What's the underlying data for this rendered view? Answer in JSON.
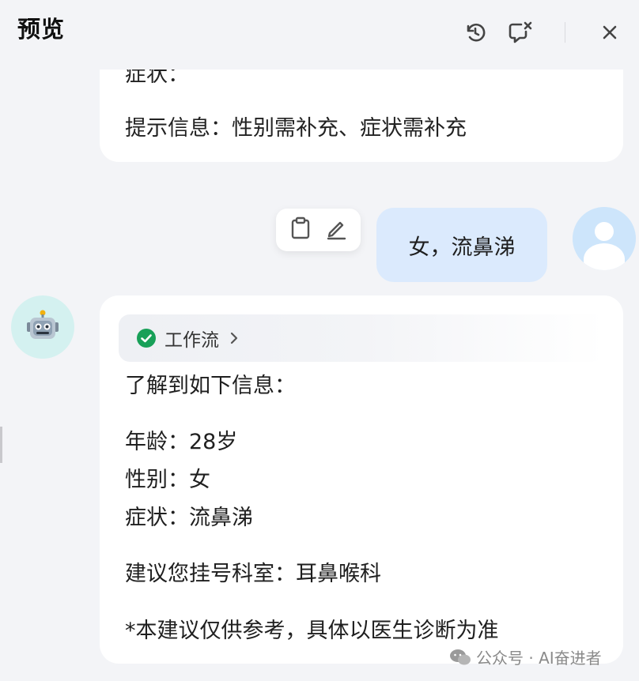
{
  "header": {
    "title": "预览",
    "icons": [
      "refresh-icon",
      "clear-chat-icon",
      "close-icon"
    ]
  },
  "messages": {
    "bot_prev": {
      "cut_line": "症状：",
      "hint_line": "提示信息：性别需补充、症状需补充"
    },
    "user": {
      "text": "女，流鼻涕",
      "actions": [
        "copy-icon",
        "edit-icon"
      ]
    },
    "bot_reply": {
      "workflow_label": "工作流",
      "intro": "了解到如下信息：",
      "age": "年龄：28岁",
      "gender": "性别：女",
      "symptom": "症状：流鼻涕",
      "advice": "建议您挂号科室：耳鼻喉科",
      "disclaimer": "*本建议仅供参考，具体以医生诊断为准"
    }
  },
  "watermark": {
    "text": "公众号 · AI奋进者"
  },
  "colors": {
    "background": "#f3f4f7",
    "user_bubble": "#dbeafd",
    "bot_bubble": "#ffffff",
    "success_green": "#18a058",
    "bot_avatar_bg": "#d4f1f0"
  }
}
